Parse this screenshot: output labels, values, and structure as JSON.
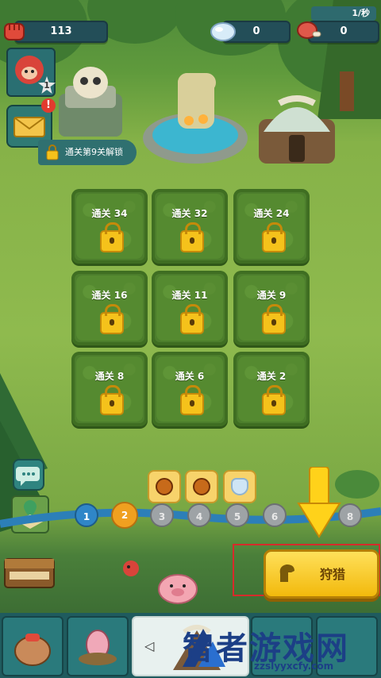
{
  "top_bar": {
    "power": "113",
    "crystal": "0",
    "meat": "0",
    "rate": "1/秒"
  },
  "avatar": {
    "level": "1"
  },
  "unlock_hint": "通关第9关解锁",
  "locked_buildings": [
    {
      "label": "通关 34"
    },
    {
      "label": "通关 32"
    },
    {
      "label": "通关 24"
    },
    {
      "label": "通关 16"
    },
    {
      "label": "通关 11"
    },
    {
      "label": "通关 9"
    },
    {
      "label": "通关 8"
    },
    {
      "label": "通关 6"
    },
    {
      "label": "通关 2"
    }
  ],
  "stages": [
    {
      "num": "1",
      "state": "done"
    },
    {
      "num": "2",
      "state": "current"
    },
    {
      "num": "3",
      "state": "todo"
    },
    {
      "num": "4",
      "state": "todo"
    },
    {
      "num": "5",
      "state": "todo"
    },
    {
      "num": "6",
      "state": "todo"
    },
    {
      "num": "8",
      "state": "todo"
    }
  ],
  "hunt_button": {
    "label": "狩猎"
  },
  "watermark": {
    "text": "智者游戏网",
    "url": "zzslyyxcfy.com"
  },
  "colors": {
    "accent_yellow": "#f5c21b",
    "highlight_frame": "#d62b2b",
    "nav_bg": "#1f5b5e"
  }
}
